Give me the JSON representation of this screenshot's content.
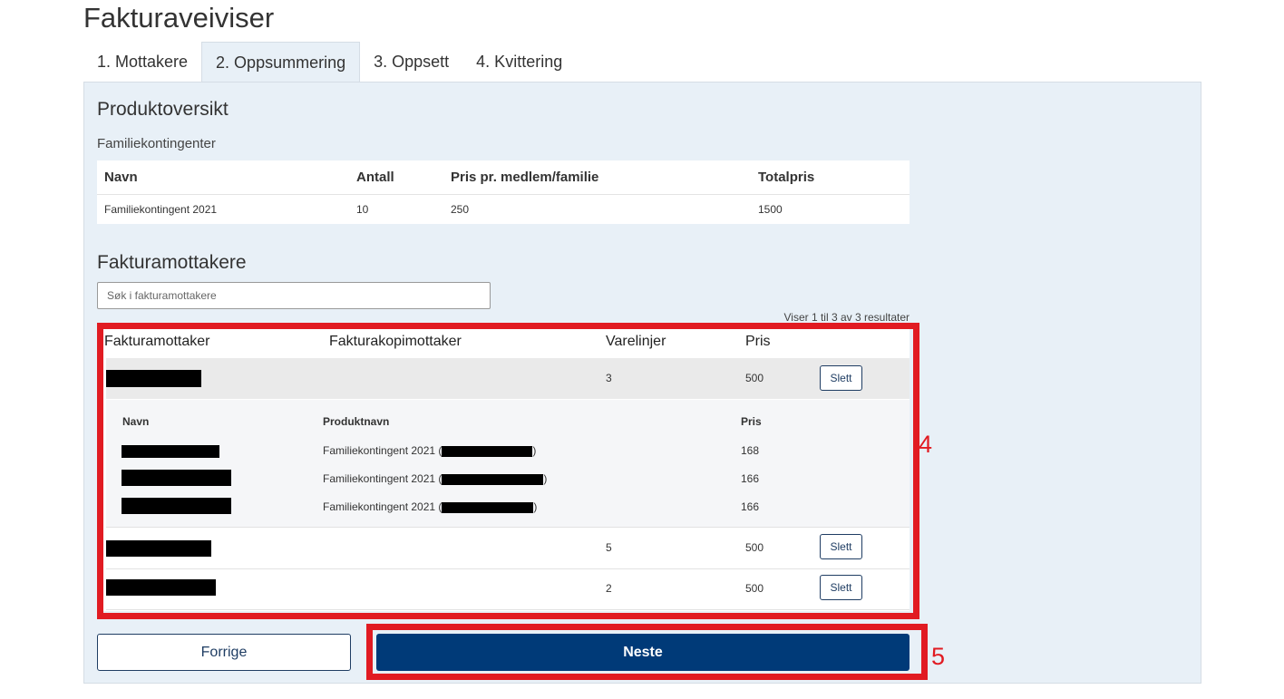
{
  "page_title": "Fakturaveiviser",
  "tabs": [
    {
      "label": "1. Mottakere",
      "active": false
    },
    {
      "label": "2. Oppsummering",
      "active": true
    },
    {
      "label": "3. Oppsett",
      "active": false
    },
    {
      "label": "4. Kvittering",
      "active": false
    }
  ],
  "product_overview": {
    "title": "Produktoversikt",
    "subtitle": "Familiekontingenter",
    "columns": [
      "Navn",
      "Antall",
      "Pris pr. medlem/familie",
      "Totalpris"
    ],
    "rows": [
      {
        "name": "Familiekontingent 2021",
        "count": "10",
        "price": "250",
        "total": "1500"
      }
    ]
  },
  "recipients": {
    "title": "Fakturamottakere",
    "search_placeholder": "Søk i fakturamottakere",
    "result_info": "Viser 1 til 3 av 3 resultater",
    "columns": [
      "Fakturamottaker",
      "Fakturakopimottaker",
      "Varelinjer",
      "Pris"
    ],
    "delete_label": "Slett",
    "rows": [
      {
        "varelinjer": "3",
        "pris": "500"
      },
      {
        "varelinjer": "5",
        "pris": "500"
      },
      {
        "varelinjer": "2",
        "pris": "500"
      }
    ],
    "detail": {
      "columns": [
        "Navn",
        "Produktnavn",
        "Pris"
      ],
      "product_prefix": "Familiekontingent 2021 (",
      "product_suffix": ")",
      "lines": [
        {
          "pris": "168"
        },
        {
          "pris": "166"
        },
        {
          "pris": "166"
        }
      ]
    }
  },
  "buttons": {
    "prev": "Forrige",
    "next": "Neste"
  },
  "annotations": {
    "label_4": "4",
    "label_5": "5",
    "color": "#e11b22"
  },
  "colors": {
    "primary": "#003a78",
    "panel_bg": "#e8f0f7"
  }
}
